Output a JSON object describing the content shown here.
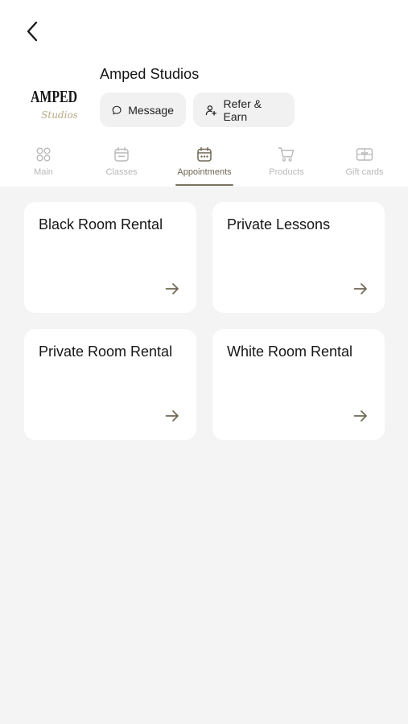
{
  "header": {
    "studio_name": "Amped Studios",
    "message_label": "Message",
    "refer_label": "Refer & Earn",
    "logo_text": "AMPED",
    "logo_script": "Studios"
  },
  "tabs": [
    {
      "label": "Main",
      "icon": "grid-icon",
      "active": false
    },
    {
      "label": "Classes",
      "icon": "calendar-icon",
      "active": false
    },
    {
      "label": "Appointments",
      "icon": "calendar-dots-icon",
      "active": true
    },
    {
      "label": "Products",
      "icon": "cart-icon",
      "active": false
    },
    {
      "label": "Gift cards",
      "icon": "gift-card-icon",
      "active": false
    }
  ],
  "cards": [
    {
      "title": "Black Room Rental"
    },
    {
      "title": "Private Lessons"
    },
    {
      "title": "Private Room Rental"
    },
    {
      "title": "White Room Rental"
    }
  ],
  "colors": {
    "accent": "#7a7260",
    "inactive": "#b9b9b9",
    "background": "#f4f4f4"
  }
}
